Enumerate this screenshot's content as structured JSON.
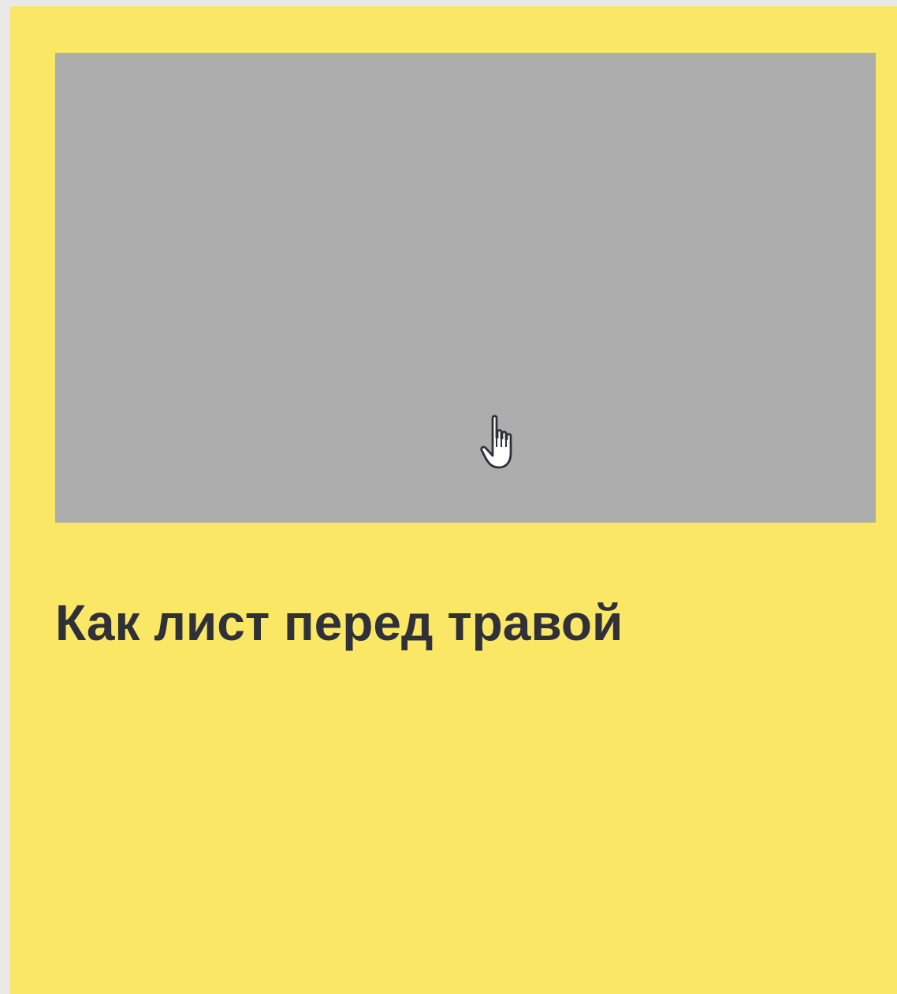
{
  "card": {
    "title": "Как лист перед травой",
    "background_color": "#fae765",
    "image_placeholder_color": "#adadad",
    "title_color": "#2f3038"
  },
  "cursor": {
    "type": "hand-pointer-icon"
  }
}
